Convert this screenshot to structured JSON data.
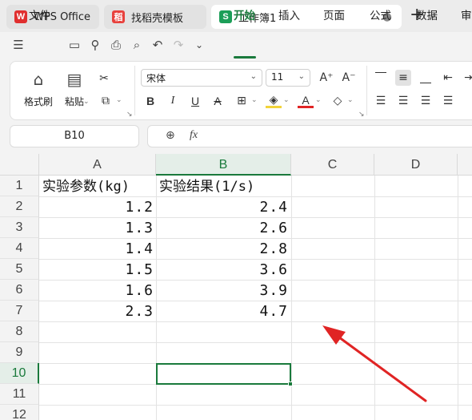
{
  "titlebar": {
    "tabs": [
      {
        "label": "WPS Office",
        "icon": "wps-logo-icon",
        "color": "#e02f2f",
        "glyph": "W"
      },
      {
        "label": "找稻壳模板",
        "icon": "docer-icon",
        "color": "#e8413d",
        "glyph": "稻"
      },
      {
        "label": "工作簿1",
        "icon": "spreadsheet-icon",
        "color": "#1c9e58",
        "glyph": "S"
      }
    ],
    "new_tab": "+"
  },
  "menu": {
    "file": "文件",
    "items": [
      "开始",
      "插入",
      "页面",
      "公式",
      "数据",
      "审"
    ],
    "active": "开始"
  },
  "ribbon": {
    "format_painter": "格式刷",
    "paste": "粘贴",
    "font_name": "宋体",
    "font_size": "11"
  },
  "namebox": "B10",
  "formula_icon": "fx",
  "grid": {
    "columns": [
      "A",
      "B",
      "C",
      "D"
    ],
    "rows": [
      "1",
      "2",
      "3",
      "4",
      "5",
      "6",
      "7",
      "8",
      "9",
      "10",
      "11",
      "12"
    ],
    "cells": {
      "A1": "实验参数(kg)",
      "B1": "实验结果(1/s)",
      "A2": "1.2",
      "B2": "2.4",
      "A3": "1.3",
      "B3": "2.6",
      "A4": "1.4",
      "B4": "2.8",
      "A5": "1.5",
      "B5": "3.6",
      "A6": "1.6",
      "B6": "3.9",
      "A7": "2.3",
      "B7": "4.7"
    },
    "selected_cell": "B10",
    "selected_column": "B",
    "selected_row": "10"
  },
  "colors": {
    "accent": "#1a7a3c",
    "arrow": "#e02424"
  }
}
